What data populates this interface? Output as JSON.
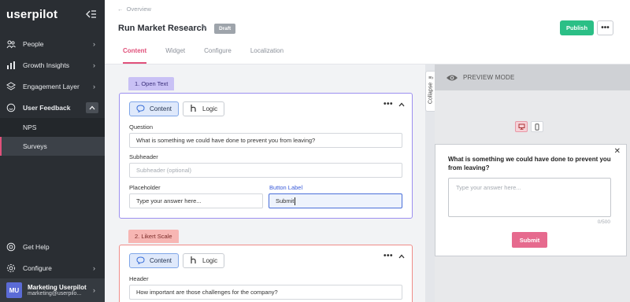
{
  "sidebar": {
    "logo": "userpilot",
    "items": [
      {
        "label": "People",
        "icon": "people-icon"
      },
      {
        "label": "Growth Insights",
        "icon": "chart-icon"
      },
      {
        "label": "Engagement Layer",
        "icon": "layers-icon"
      },
      {
        "label": "User Feedback",
        "icon": "feedback-icon"
      }
    ],
    "sub_items": [
      "NPS",
      "Surveys"
    ],
    "bottom_items": [
      {
        "label": "Get Help",
        "icon": "help-icon"
      },
      {
        "label": "Configure",
        "icon": "gear-icon"
      }
    ],
    "user": {
      "initials": "MU",
      "name": "Marketing Userpilot",
      "email": "marketing@userpilo..."
    }
  },
  "header": {
    "breadcrumb": "Overview",
    "title": "Run Market Research",
    "status_badge": "Draft",
    "publish_label": "Publish",
    "more_label": "•••",
    "tabs": [
      "Content",
      "Widget",
      "Configure",
      "Localization"
    ],
    "active_tab": "Content"
  },
  "editor": {
    "step1": {
      "label": "1. Open Text",
      "content_pill": "Content",
      "logic_pill": "Logic",
      "question_label": "Question",
      "question_value": "What is something we could have done to prevent you from leaving?",
      "subheader_label": "Subheader",
      "subheader_placeholder": "Subheader (optional)",
      "placeholder_label": "Placeholder",
      "placeholder_value": "Type your answer here...",
      "button_label_label": "Button Label",
      "button_label_value": "Submit"
    },
    "step2": {
      "label": "2. Likert Scale",
      "content_pill": "Content",
      "logic_pill": "Logic",
      "header_label": "Header",
      "header_value": "How important are those challenges for the company?"
    }
  },
  "splitter": {
    "collapse_label": "Collapse"
  },
  "preview": {
    "title": "PREVIEW MODE",
    "question": "What is something we could have done to prevent you from leaving?",
    "textarea_placeholder": "Type your answer here...",
    "char_count": "0/500",
    "submit_label": "Submit",
    "close_glyph": "✕"
  },
  "colors": {
    "accent": "#e0507a",
    "publish": "#2bbf86",
    "sidebar_bg": "#2a2e33",
    "step1_border": "#9c8ff0",
    "step2_border": "#f08c88"
  }
}
